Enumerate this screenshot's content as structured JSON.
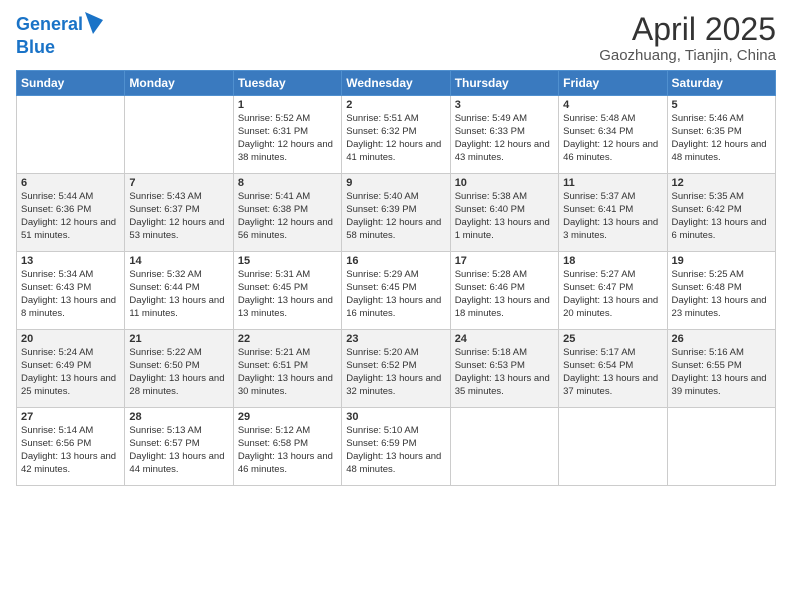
{
  "header": {
    "logo_line1": "General",
    "logo_line2": "Blue",
    "title": "April 2025",
    "subtitle": "Gaozhuang, Tianjin, China"
  },
  "days_of_week": [
    "Sunday",
    "Monday",
    "Tuesday",
    "Wednesday",
    "Thursday",
    "Friday",
    "Saturday"
  ],
  "weeks": [
    [
      {
        "day": "",
        "text": ""
      },
      {
        "day": "",
        "text": ""
      },
      {
        "day": "1",
        "text": "Sunrise: 5:52 AM\nSunset: 6:31 PM\nDaylight: 12 hours and 38 minutes."
      },
      {
        "day": "2",
        "text": "Sunrise: 5:51 AM\nSunset: 6:32 PM\nDaylight: 12 hours and 41 minutes."
      },
      {
        "day": "3",
        "text": "Sunrise: 5:49 AM\nSunset: 6:33 PM\nDaylight: 12 hours and 43 minutes."
      },
      {
        "day": "4",
        "text": "Sunrise: 5:48 AM\nSunset: 6:34 PM\nDaylight: 12 hours and 46 minutes."
      },
      {
        "day": "5",
        "text": "Sunrise: 5:46 AM\nSunset: 6:35 PM\nDaylight: 12 hours and 48 minutes."
      }
    ],
    [
      {
        "day": "6",
        "text": "Sunrise: 5:44 AM\nSunset: 6:36 PM\nDaylight: 12 hours and 51 minutes."
      },
      {
        "day": "7",
        "text": "Sunrise: 5:43 AM\nSunset: 6:37 PM\nDaylight: 12 hours and 53 minutes."
      },
      {
        "day": "8",
        "text": "Sunrise: 5:41 AM\nSunset: 6:38 PM\nDaylight: 12 hours and 56 minutes."
      },
      {
        "day": "9",
        "text": "Sunrise: 5:40 AM\nSunset: 6:39 PM\nDaylight: 12 hours and 58 minutes."
      },
      {
        "day": "10",
        "text": "Sunrise: 5:38 AM\nSunset: 6:40 PM\nDaylight: 13 hours and 1 minute."
      },
      {
        "day": "11",
        "text": "Sunrise: 5:37 AM\nSunset: 6:41 PM\nDaylight: 13 hours and 3 minutes."
      },
      {
        "day": "12",
        "text": "Sunrise: 5:35 AM\nSunset: 6:42 PM\nDaylight: 13 hours and 6 minutes."
      }
    ],
    [
      {
        "day": "13",
        "text": "Sunrise: 5:34 AM\nSunset: 6:43 PM\nDaylight: 13 hours and 8 minutes."
      },
      {
        "day": "14",
        "text": "Sunrise: 5:32 AM\nSunset: 6:44 PM\nDaylight: 13 hours and 11 minutes."
      },
      {
        "day": "15",
        "text": "Sunrise: 5:31 AM\nSunset: 6:45 PM\nDaylight: 13 hours and 13 minutes."
      },
      {
        "day": "16",
        "text": "Sunrise: 5:29 AM\nSunset: 6:45 PM\nDaylight: 13 hours and 16 minutes."
      },
      {
        "day": "17",
        "text": "Sunrise: 5:28 AM\nSunset: 6:46 PM\nDaylight: 13 hours and 18 minutes."
      },
      {
        "day": "18",
        "text": "Sunrise: 5:27 AM\nSunset: 6:47 PM\nDaylight: 13 hours and 20 minutes."
      },
      {
        "day": "19",
        "text": "Sunrise: 5:25 AM\nSunset: 6:48 PM\nDaylight: 13 hours and 23 minutes."
      }
    ],
    [
      {
        "day": "20",
        "text": "Sunrise: 5:24 AM\nSunset: 6:49 PM\nDaylight: 13 hours and 25 minutes."
      },
      {
        "day": "21",
        "text": "Sunrise: 5:22 AM\nSunset: 6:50 PM\nDaylight: 13 hours and 28 minutes."
      },
      {
        "day": "22",
        "text": "Sunrise: 5:21 AM\nSunset: 6:51 PM\nDaylight: 13 hours and 30 minutes."
      },
      {
        "day": "23",
        "text": "Sunrise: 5:20 AM\nSunset: 6:52 PM\nDaylight: 13 hours and 32 minutes."
      },
      {
        "day": "24",
        "text": "Sunrise: 5:18 AM\nSunset: 6:53 PM\nDaylight: 13 hours and 35 minutes."
      },
      {
        "day": "25",
        "text": "Sunrise: 5:17 AM\nSunset: 6:54 PM\nDaylight: 13 hours and 37 minutes."
      },
      {
        "day": "26",
        "text": "Sunrise: 5:16 AM\nSunset: 6:55 PM\nDaylight: 13 hours and 39 minutes."
      }
    ],
    [
      {
        "day": "27",
        "text": "Sunrise: 5:14 AM\nSunset: 6:56 PM\nDaylight: 13 hours and 42 minutes."
      },
      {
        "day": "28",
        "text": "Sunrise: 5:13 AM\nSunset: 6:57 PM\nDaylight: 13 hours and 44 minutes."
      },
      {
        "day": "29",
        "text": "Sunrise: 5:12 AM\nSunset: 6:58 PM\nDaylight: 13 hours and 46 minutes."
      },
      {
        "day": "30",
        "text": "Sunrise: 5:10 AM\nSunset: 6:59 PM\nDaylight: 13 hours and 48 minutes."
      },
      {
        "day": "",
        "text": ""
      },
      {
        "day": "",
        "text": ""
      },
      {
        "day": "",
        "text": ""
      }
    ]
  ]
}
